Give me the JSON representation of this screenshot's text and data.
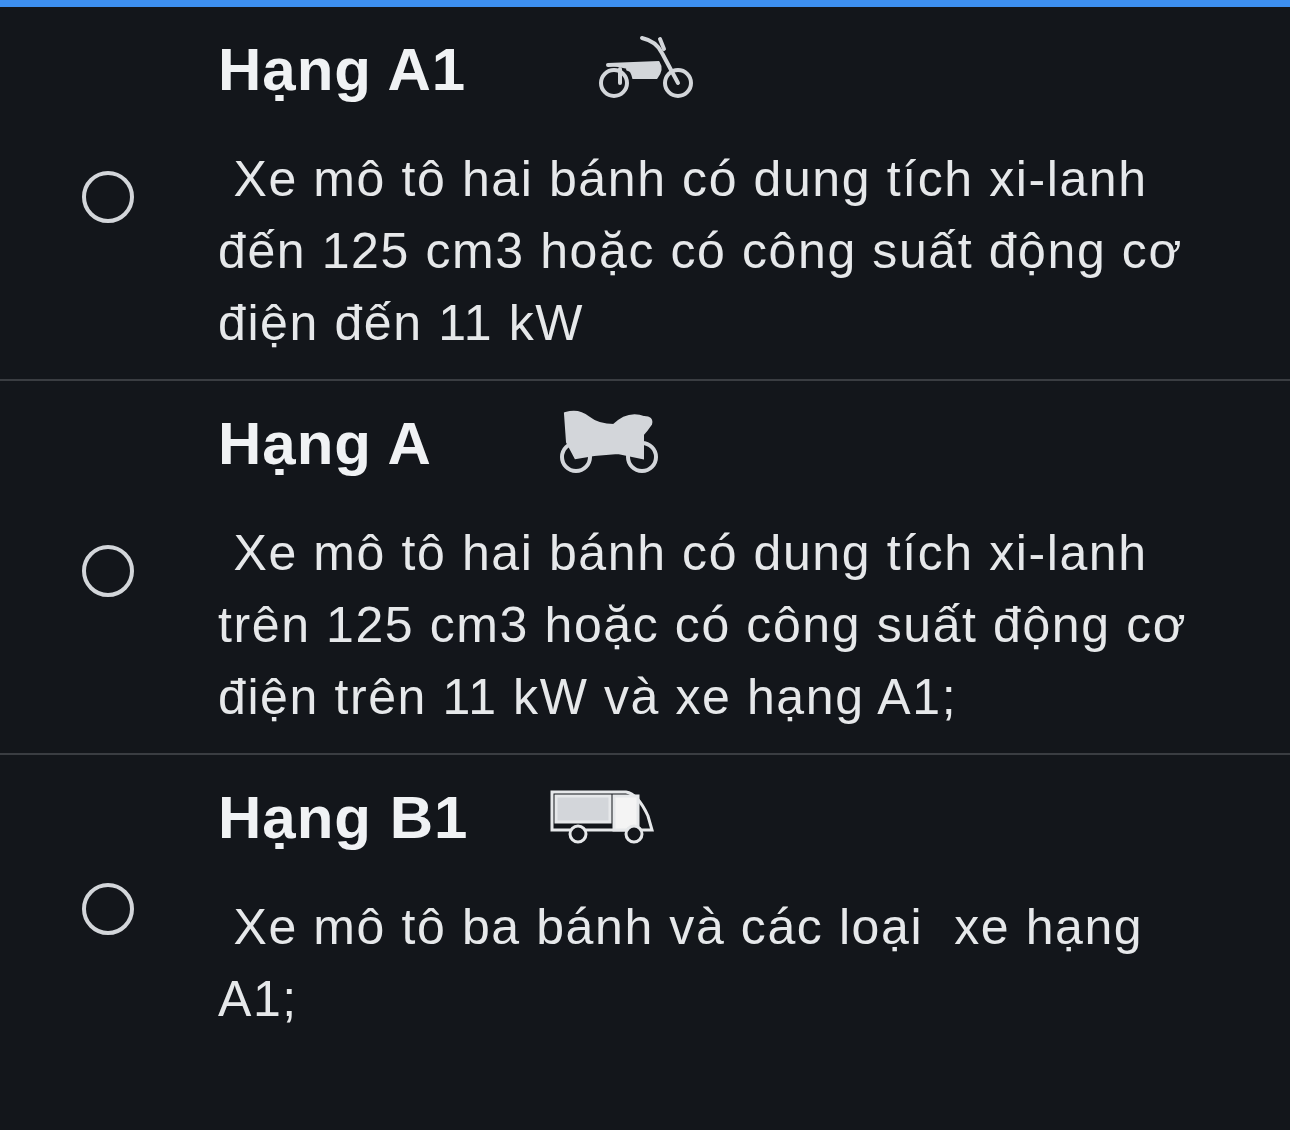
{
  "options": [
    {
      "title": "Hạng A1",
      "kind": "scooter",
      "description": " Xe mô tô hai bánh có dung tích xi-lanh đến 125 cm3 hoặc có công suất động cơ điện đến 11 kW",
      "selected": false
    },
    {
      "title": "Hạng A",
      "kind": "motorbike",
      "description": " Xe mô tô hai bánh có dung tích xi-lanh trên 125 cm3 hoặc có công suất động cơ điện trên 11 kW và xe hạng A1;",
      "selected": false
    },
    {
      "title": "Hạng B1",
      "kind": "van",
      "description": " Xe mô tô ba bánh và các loại  xe hạng A1;",
      "selected": false
    }
  ]
}
